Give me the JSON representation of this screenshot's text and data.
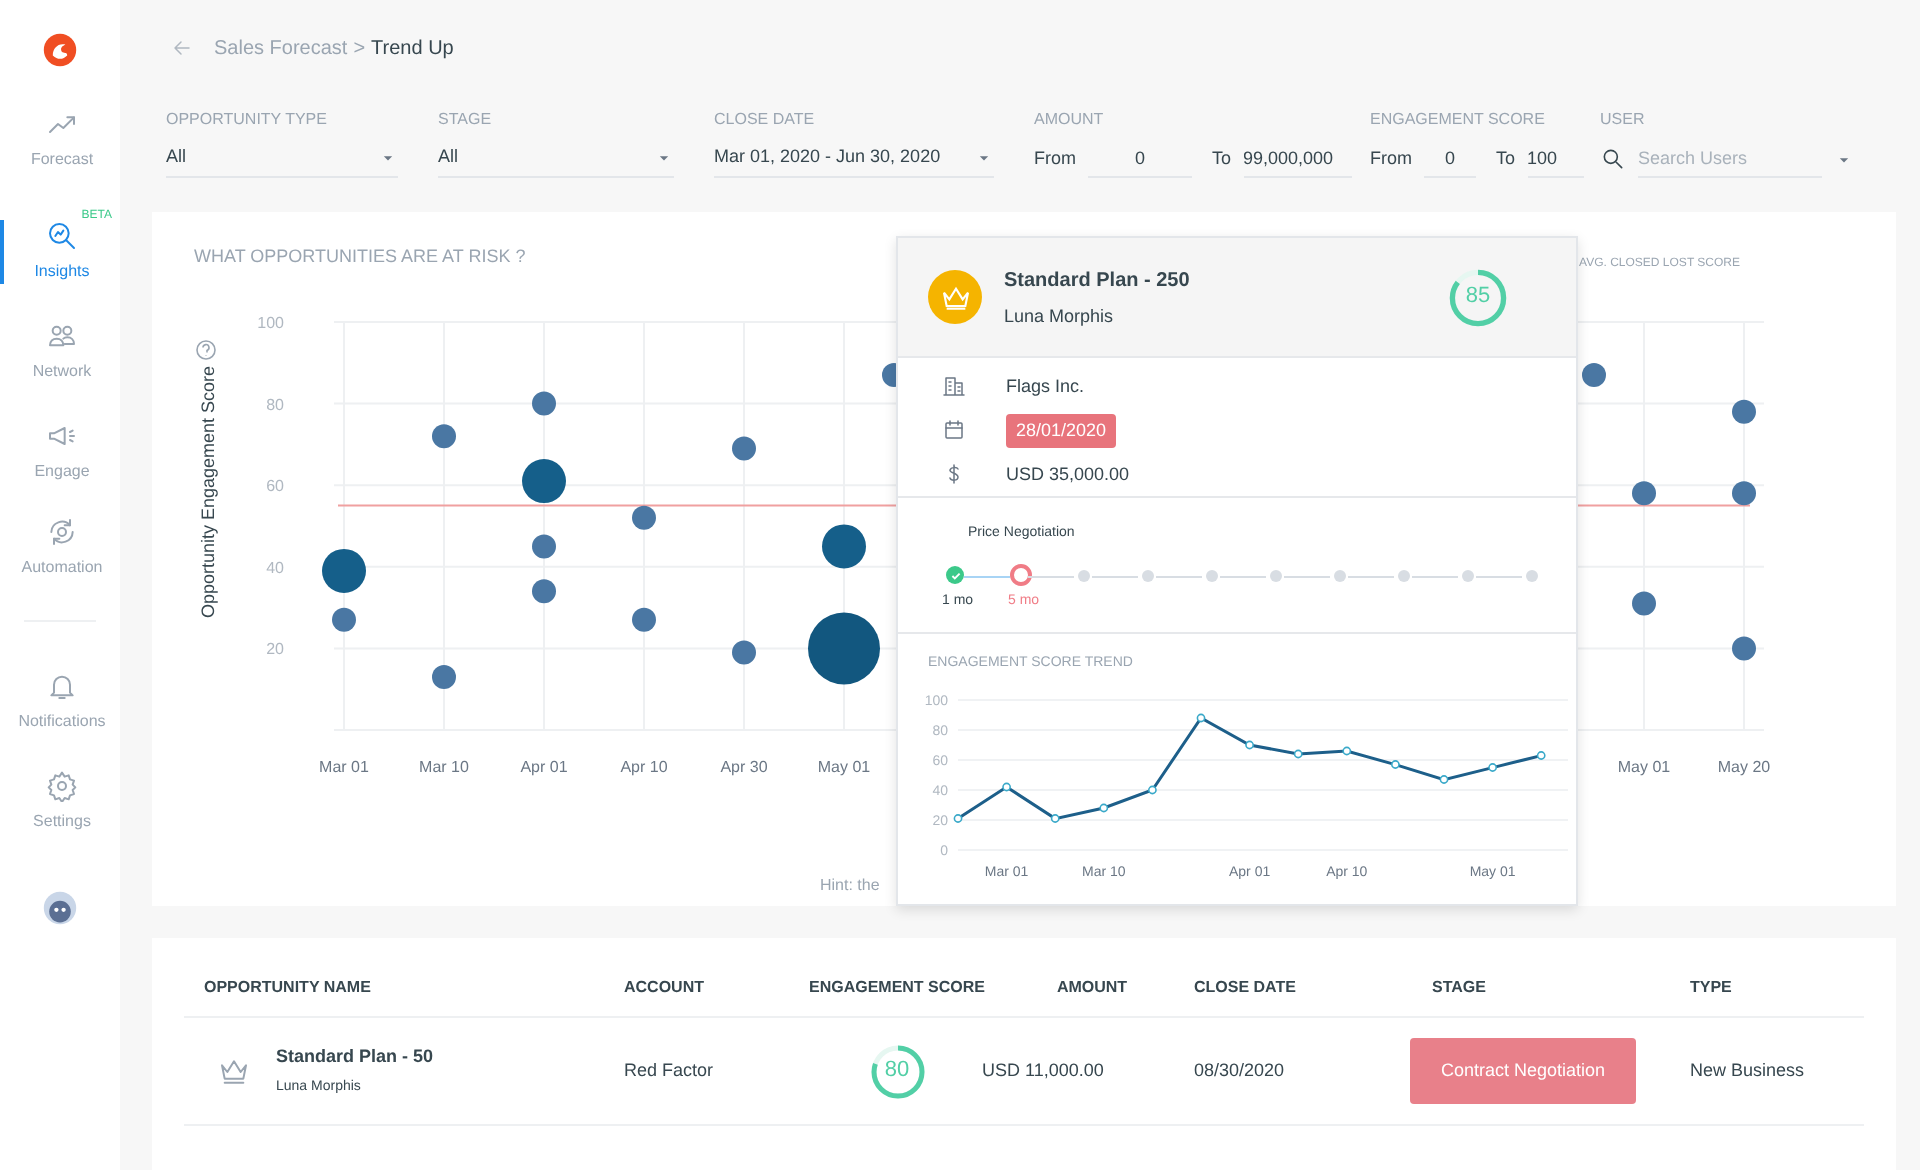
{
  "sidebar": {
    "items": [
      {
        "label": "Forecast",
        "selected": false
      },
      {
        "label": "Insights",
        "selected": true,
        "badge": "BETA"
      },
      {
        "label": "Network",
        "selected": false
      },
      {
        "label": "Engage",
        "selected": false
      },
      {
        "label": "Automation",
        "selected": false
      },
      {
        "label": "Notifications",
        "selected": false
      },
      {
        "label": "Settings",
        "selected": false
      }
    ]
  },
  "breadcrumb": {
    "parent": "Sales Forecast",
    "separator": ">",
    "current": "Trend Up"
  },
  "filters": [
    {
      "kind": "select",
      "label": "OPPORTUNITY TYPE",
      "value": "All"
    },
    {
      "kind": "select",
      "label": "STAGE",
      "value": "All"
    },
    {
      "kind": "select",
      "label": "CLOSE DATE",
      "value": "Mar 01, 2020 - Jun 30, 2020"
    },
    {
      "kind": "range",
      "label": "AMOUNT",
      "from_label": "From",
      "from": "0",
      "to_label": "To",
      "to": "99,000,000"
    },
    {
      "kind": "range",
      "label": "ENGAGEMENT SCORE",
      "from_label": "From",
      "from": "0",
      "to_label": "To",
      "to": "100"
    },
    {
      "kind": "search",
      "label": "USER",
      "placeholder": "Search Users"
    }
  ],
  "risk_chart": {
    "title": "WHAT OPPORTUNITIES ARE AT RISK ?",
    "legend": "AVG. CLOSED LOST SCORE",
    "hint": "Hint: the",
    "chart_data": {
      "type": "scatter",
      "ylabel": "Opportunity Engagement Score",
      "ylim": [
        0,
        100
      ],
      "yticks": [
        20,
        40,
        60,
        80,
        100
      ],
      "categories": [
        "Mar 01",
        null,
        "Mar 10",
        null,
        "Apr 01",
        null,
        "Apr 10",
        null,
        "Apr 30",
        null,
        "May 01",
        null,
        null,
        null,
        null,
        null,
        null,
        null,
        null,
        null,
        null,
        null,
        null,
        null,
        null,
        null,
        "May 01",
        null,
        "May 20"
      ],
      "grid": true,
      "series": [
        {
          "color": "#4a77a3",
          "marker": "circle",
          "values": [
            27,
            null,
            72,
            null,
            80,
            null,
            52,
            null,
            69,
            null,
            null,
            87,
            null,
            null,
            null,
            null,
            null,
            null,
            null,
            null,
            null,
            null,
            null,
            null,
            null,
            87,
            58,
            null,
            78
          ]
        },
        {
          "color": "#4a77a3",
          "marker": "circle",
          "values": [
            null,
            null,
            13,
            null,
            45,
            null,
            27,
            null,
            19,
            null,
            null,
            null,
            null,
            null,
            null,
            null,
            null,
            null,
            null,
            null,
            null,
            null,
            null,
            null,
            null,
            null,
            31,
            null,
            58
          ]
        },
        {
          "color": "#4a77a3",
          "marker": "circle",
          "values": [
            null,
            null,
            null,
            null,
            34,
            null,
            null,
            null,
            null,
            null,
            null,
            null,
            null,
            null,
            null,
            null,
            null,
            null,
            null,
            null,
            null,
            null,
            null,
            null,
            null,
            null,
            null,
            null,
            20
          ]
        },
        {
          "color": "#155f8a",
          "marker": "circle",
          "values": [
            39,
            null,
            null,
            null,
            61,
            null,
            null,
            null,
            null,
            null,
            45,
            null,
            null,
            null,
            null,
            null,
            null,
            null,
            null,
            null,
            null,
            null,
            null,
            null,
            null,
            null,
            null,
            null,
            null
          ]
        },
        {
          "color": "#12577f",
          "marker": "circle",
          "values": [
            null,
            null,
            null,
            null,
            null,
            null,
            null,
            null,
            null,
            null,
            20,
            null,
            null,
            null,
            null,
            null,
            null,
            null,
            null,
            null,
            null,
            null,
            null,
            null,
            null,
            null,
            null,
            null,
            null
          ]
        }
      ],
      "ref_lines": [
        {
          "axis": "y",
          "value": 55,
          "color": "#f0a0a0"
        }
      ]
    }
  },
  "popover": {
    "title": "Standard Plan - 250",
    "owner": "Luna Morphis",
    "score": "85",
    "level": 0.85,
    "account": "Flags Inc.",
    "date": "28/01/2020",
    "amount": "USD 35,000.00",
    "stage": "Price Negotiation",
    "steps": [
      {
        "kind": "done",
        "label": "1 mo"
      },
      {
        "kind": "current",
        "label": "5 mo"
      },
      {
        "kind": "pending"
      },
      {
        "kind": "pending"
      },
      {
        "kind": "pending"
      },
      {
        "kind": "pending"
      },
      {
        "kind": "pending"
      },
      {
        "kind": "pending"
      },
      {
        "kind": "pending"
      },
      {
        "kind": "pending"
      }
    ],
    "trend_title": "ENGAGEMENT SCORE TREND",
    "chart_data": {
      "type": "line",
      "ylim": [
        0,
        100
      ],
      "yticks": [
        0,
        20,
        40,
        60,
        80,
        100
      ],
      "grid": true,
      "categories": [
        null,
        "Mar 01",
        null,
        "Mar 10",
        null,
        null,
        "Apr 01",
        null,
        "Apr 10",
        null,
        null,
        "May 01",
        null
      ],
      "series": [
        {
          "color": "#1d5f8a",
          "marker": "circle",
          "values": [
            21,
            42,
            21,
            28,
            40,
            88,
            70,
            64,
            66,
            57,
            47,
            55,
            63
          ]
        }
      ]
    }
  },
  "table": {
    "columns": [
      "OPPORTUNITY NAME",
      "ACCOUNT",
      "ENGAGEMENT SCORE",
      "AMOUNT",
      "CLOSE DATE",
      "STAGE",
      "TYPE"
    ],
    "rows": [
      {
        "name": "Standard Plan - 50",
        "owner": "Luna Morphis",
        "account": "Red Factor",
        "score": "80",
        "level": 0.8,
        "amount": "USD 11,000.00",
        "close_date": "08/30/2020",
        "stage": "Contract Negotiation",
        "type": "New Business"
      }
    ]
  }
}
